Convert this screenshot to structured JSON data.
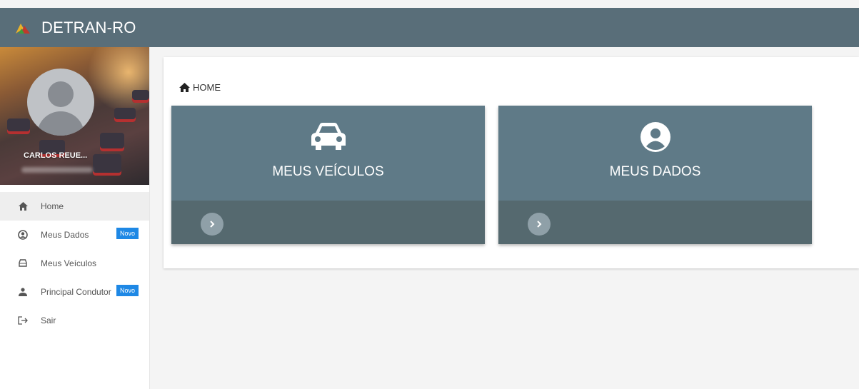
{
  "header": {
    "title": "DETRAN-RO"
  },
  "profile": {
    "name": "CARLOS REUE..."
  },
  "menu": {
    "items": [
      {
        "label": "Home",
        "icon": "home-icon",
        "active": true
      },
      {
        "label": "Meus Dados",
        "icon": "account-circle-icon",
        "badge": "Novo"
      },
      {
        "label": "Meus Veículos",
        "icon": "car-icon"
      },
      {
        "label": "Principal Condutor",
        "icon": "person-icon",
        "badge": "Novo"
      },
      {
        "label": "Sair",
        "icon": "logout-icon"
      }
    ]
  },
  "breadcrumb": {
    "label": "HOME"
  },
  "cards": [
    {
      "title": "MEUS VEÍCULOS",
      "icon": "car-icon"
    },
    {
      "title": "MEUS DADOS",
      "icon": "account-circle-icon"
    }
  ],
  "colors": {
    "header_bg": "#596e79",
    "card_bg": "#5f7a87",
    "card_footer": "#55696f",
    "badge": "#1e88e5"
  }
}
